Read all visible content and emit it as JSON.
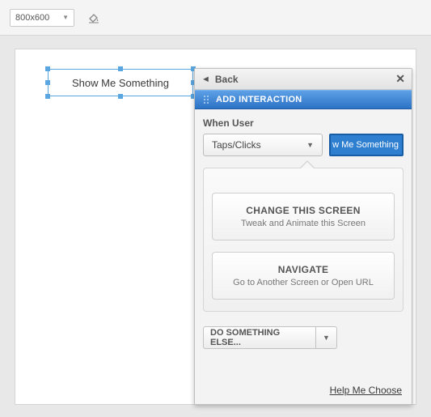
{
  "toolbar": {
    "canvas_size": "800x600"
  },
  "canvas": {
    "button_label": "Show Me Something"
  },
  "panel": {
    "back_label": "Back",
    "title": "ADD INTERACTION",
    "when_label": "When User",
    "trigger_value": "Taps/Clicks",
    "target_chip_text": "w Me Something",
    "options": [
      {
        "title": "CHANGE THIS SCREEN",
        "subtitle": "Tweak and Animate this Screen"
      },
      {
        "title": "NAVIGATE",
        "subtitle": "Go to Another Screen or Open URL"
      }
    ],
    "else_label": "DO SOMETHING ELSE...",
    "help_label": "Help Me Choose"
  }
}
